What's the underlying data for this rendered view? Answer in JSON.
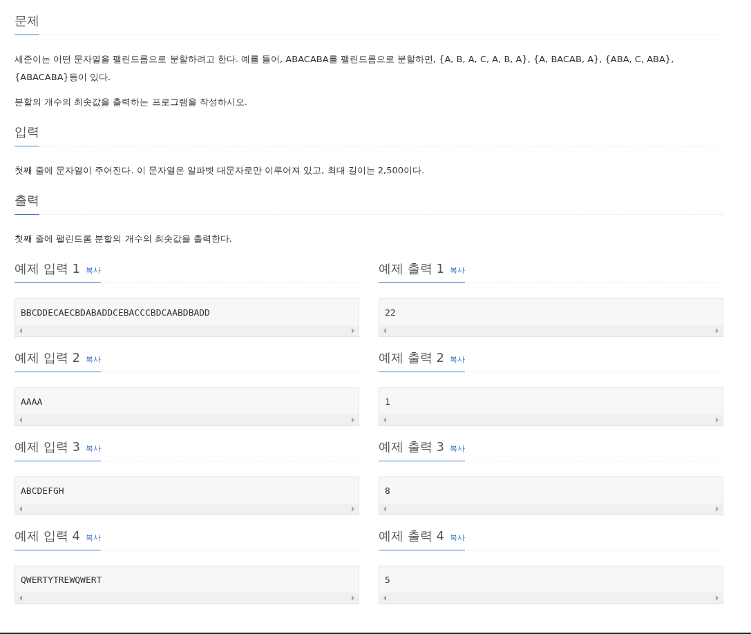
{
  "sections": [
    {
      "title": "문제",
      "paragraphs": [
        "세준이는 어떤 문자열을 팰린드롬으로 분할하려고 한다. 예를 들어, ABACABA를 팰린드롬으로 분할하면, {A, B, A, C, A, B, A}, {A, BACAB, A}, {ABA, C, ABA}, {ABACABA}등이 있다.",
        "분할의 개수의 최솟값을 출력하는 프로그램을 작성하시오."
      ]
    },
    {
      "title": "입력",
      "paragraphs": [
        "첫째 줄에 문자열이 주어진다. 이 문자열은 알파벳 대문자로만 이루어져 있고, 최대 길이는 2,500이다."
      ]
    },
    {
      "title": "출력",
      "paragraphs": [
        "첫째 줄에 팰린드롬 분할의 개수의 최솟값을 출력한다."
      ]
    }
  ],
  "examples": [
    {
      "input": {
        "title": "예제 입력 1",
        "copy": "복사",
        "value": "BBCDDECAECBDABADDCEBACCCBDCAABDBADD"
      },
      "output": {
        "title": "예제 출력 1",
        "copy": "복사",
        "value": "22"
      }
    },
    {
      "input": {
        "title": "예제 입력 2",
        "copy": "복사",
        "value": "AAAA"
      },
      "output": {
        "title": "예제 출력 2",
        "copy": "복사",
        "value": "1"
      }
    },
    {
      "input": {
        "title": "예제 입력 3",
        "copy": "복사",
        "value": "ABCDEFGH"
      },
      "output": {
        "title": "예제 출력 3",
        "copy": "복사",
        "value": "8"
      }
    },
    {
      "input": {
        "title": "예제 입력 4",
        "copy": "복사",
        "value": "QWERTYTREWQWERT"
      },
      "output": {
        "title": "예제 출력 4",
        "copy": "복사",
        "value": "5"
      }
    }
  ]
}
